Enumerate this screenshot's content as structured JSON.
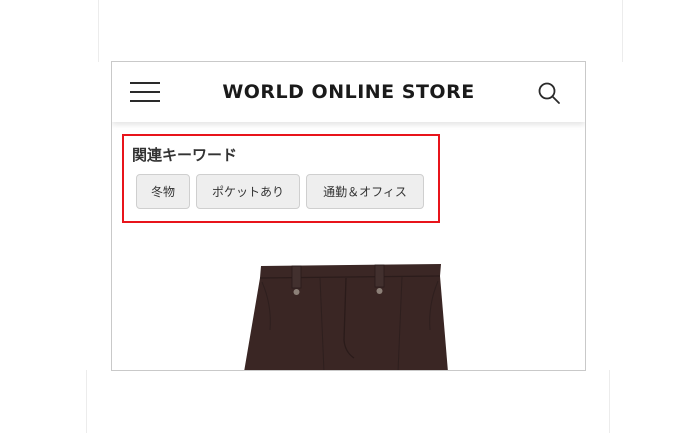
{
  "header": {
    "store_name": "WORLD ONLINE STORE",
    "menu_icon": "hamburger-menu-icon",
    "search_icon": "search-icon"
  },
  "related_keywords": {
    "title": "関連キーワード",
    "highlight_color": "#e8141b",
    "chips": [
      {
        "label": "冬物"
      },
      {
        "label": "ポケットあり"
      },
      {
        "label": "通勤＆オフィス"
      }
    ]
  },
  "product": {
    "image": "dark-brown-trousers",
    "color": "#3a2624"
  }
}
